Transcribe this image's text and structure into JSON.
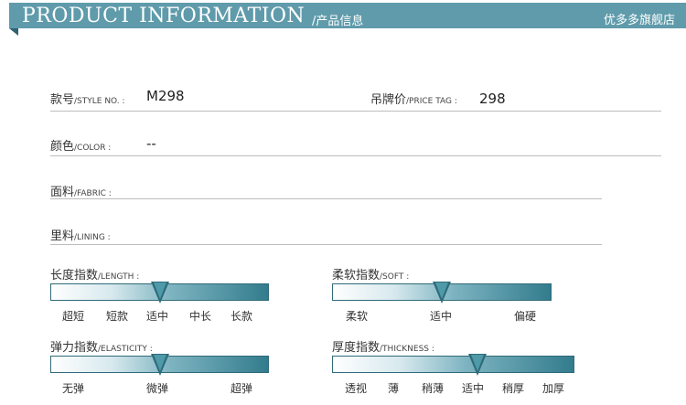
{
  "header": {
    "title": "PRODUCT INFORMATION",
    "subtitle": "/产品信息",
    "store": "优多多旗舰店"
  },
  "fields": {
    "style": {
      "cn": "款号",
      "en": "/STYLE NO. :",
      "value": "M298"
    },
    "price": {
      "cn": "吊牌价",
      "en": "/PRICE TAG :",
      "value": "298"
    },
    "color": {
      "cn": "颜色",
      "en": "/COLOR :",
      "value": "--"
    },
    "fabric": {
      "cn": "面料",
      "en": "/FABRIC :",
      "value": ""
    },
    "lining": {
      "cn": "里料",
      "en": "/LINING :",
      "value": ""
    }
  },
  "scales": {
    "length": {
      "cn": "长度指数",
      "en": "/LENGTH :",
      "ticks": [
        "超短",
        "短款",
        "适中",
        "中长",
        "长款"
      ],
      "selected": "适中",
      "level": 0.5
    },
    "soft": {
      "cn": "柔软指数",
      "en": "/SOFT :",
      "ticks": [
        "柔软",
        "适中",
        "偏硬"
      ],
      "selected": "适中",
      "level": 0.5
    },
    "elasticity": {
      "cn": "弹力指数",
      "en": "/ELASTICITY :",
      "ticks": [
        "无弹",
        "微弹",
        "超弹"
      ],
      "selected": "微弹",
      "level": 0.5
    },
    "thickness": {
      "cn": "厚度指数",
      "en": "/THICKNESS :",
      "ticks": [
        "透视",
        "薄",
        "稍薄",
        "适中",
        "稍厚",
        "加厚"
      ],
      "selected": "适中",
      "level": 0.6
    }
  },
  "colors": {
    "accent": "#5f9bab",
    "bar_dark": "#2f6b79"
  }
}
